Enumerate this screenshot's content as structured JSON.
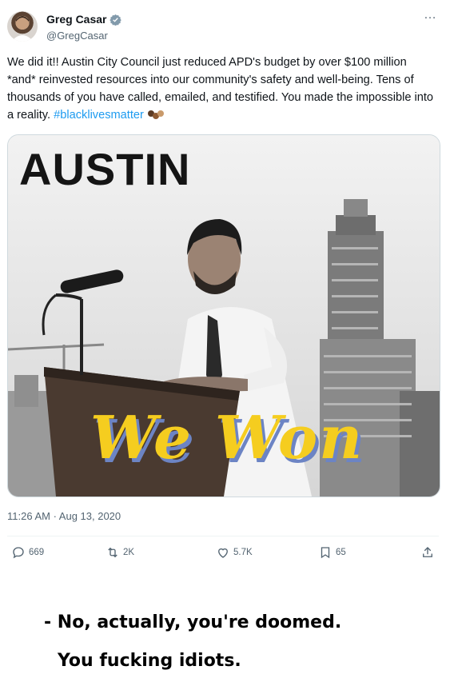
{
  "author": {
    "name": "Greg Casar",
    "handle": "@GregCasar"
  },
  "tweet": {
    "text": "We did it!! Austin City Council just reduced APD's budget by over $100 million *and* reinvested resources into our community's safety and well-being. Tens of thousands of you have called, emailed, and testified. You made the impossible into a reality. ",
    "hashtag": "#blacklivesmatter",
    "timestamp": "11:26 AM · Aug 13, 2020"
  },
  "media": {
    "title": "AUSTIN",
    "banner": "We Won"
  },
  "actions": {
    "replies": "669",
    "retweets": "2K",
    "likes": "5.7K",
    "bookmarks": "65"
  },
  "caption": {
    "line1": "- No, actually, you're doomed.",
    "line2": "You fucking idiots."
  },
  "more_icon": "…",
  "colors": {
    "link": "#1d9bf0",
    "verified": "#829aab",
    "banner": "#f5cd1f"
  }
}
